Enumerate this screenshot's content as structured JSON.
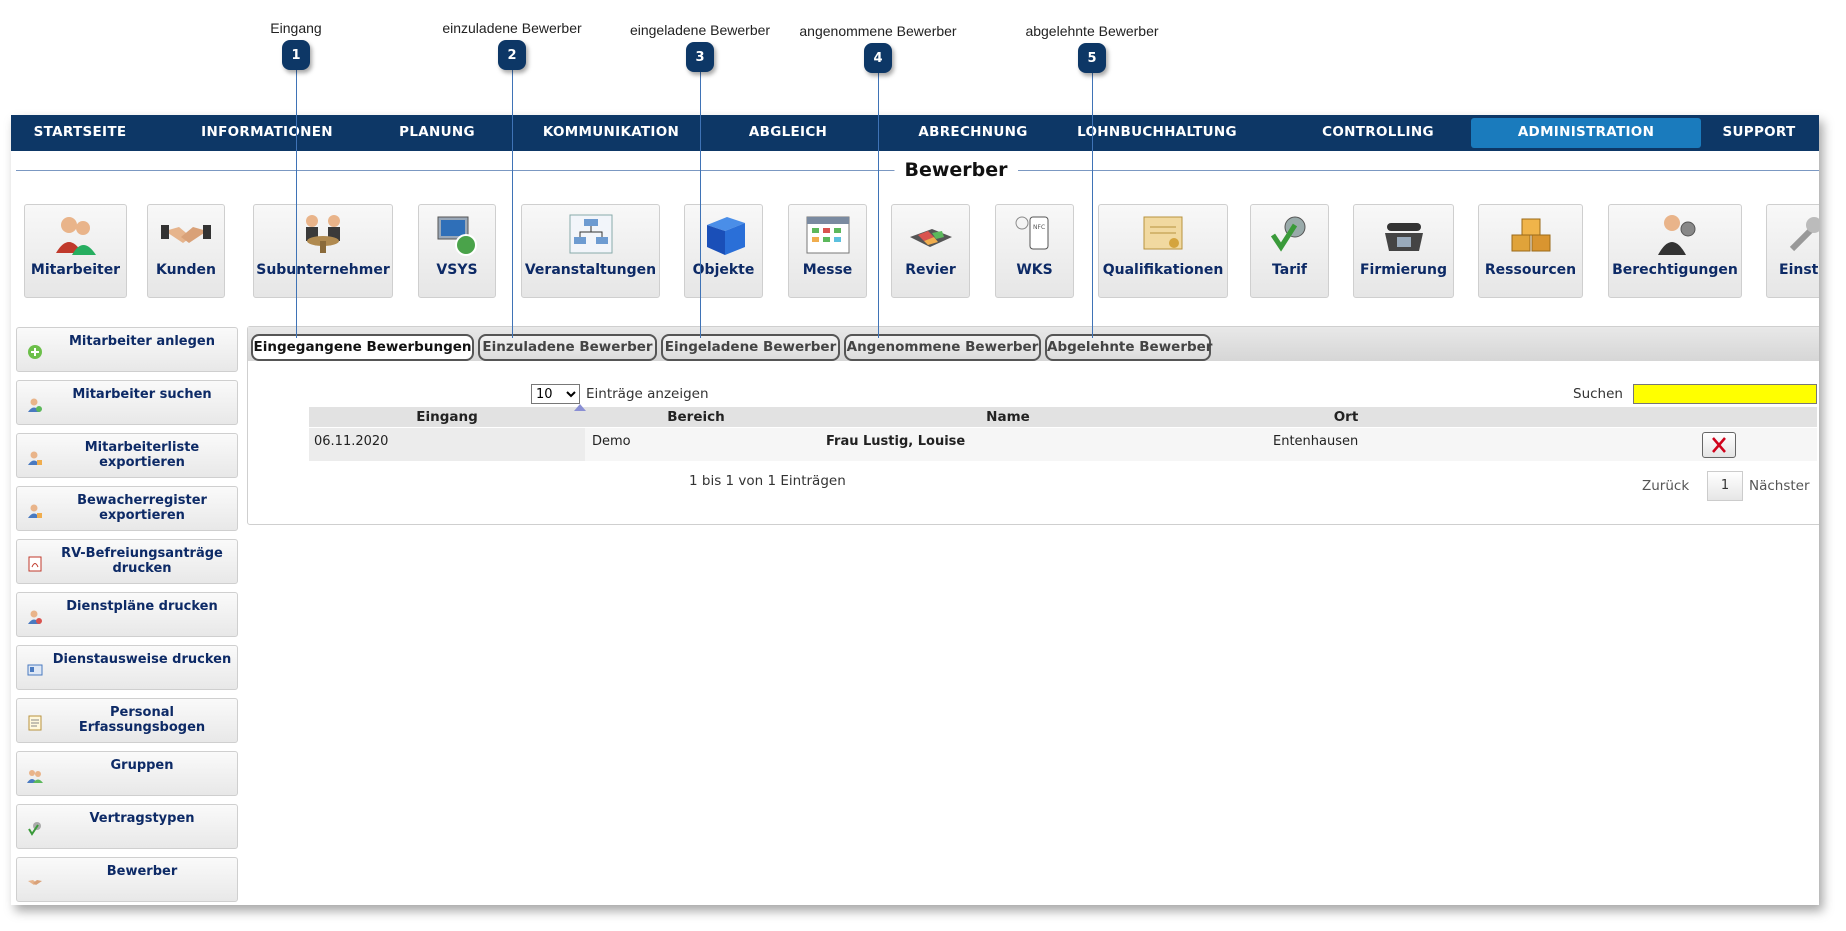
{
  "annotations": [
    {
      "number": "1",
      "label": "Eingang"
    },
    {
      "number": "2",
      "label": "einzuladene Bewerber"
    },
    {
      "number": "3",
      "label": "eingeladene Bewerber"
    },
    {
      "number": "4",
      "label": "angenommene Bewerber"
    },
    {
      "number": "5",
      "label": "abgelehnte Bewerber"
    }
  ],
  "nav": {
    "items": [
      "STARTSEITE",
      "INFORMATIONEN",
      "PLANUNG",
      "KOMMUNIKATION",
      "ABGLEICH",
      "ABRECHNUNG",
      "LOHNBUCHHALTUNG",
      "CONTROLLING",
      "ADMINISTRATION",
      "SUPPORT"
    ],
    "active": "ADMINISTRATION",
    "active_color": "#1a7bbd",
    "bar_color": "#0d3766"
  },
  "page_title": "Bewerber",
  "modules": [
    {
      "label": "Mitarbeiter",
      "icon": "users-icon"
    },
    {
      "label": "Kunden",
      "icon": "handshake-icon"
    },
    {
      "label": "Subunternehmer",
      "icon": "partners-icon"
    },
    {
      "label": "VSYS",
      "icon": "computer-icon"
    },
    {
      "label": "Veranstaltungen",
      "icon": "org-chart-icon"
    },
    {
      "label": "Objekte",
      "icon": "cube-icon"
    },
    {
      "label": "Messe",
      "icon": "calendar-icon"
    },
    {
      "label": "Revier",
      "icon": "map-icon"
    },
    {
      "label": "WKS",
      "icon": "nfc-icon"
    },
    {
      "label": "Qualifikationen",
      "icon": "certificate-icon"
    },
    {
      "label": "Tarif",
      "icon": "tariff-icon"
    },
    {
      "label": "Firmierung",
      "icon": "telephone-icon"
    },
    {
      "label": "Ressourcen",
      "icon": "boxes-icon"
    },
    {
      "label": "Berechtigungen",
      "icon": "admin-user-icon"
    },
    {
      "label": "Einste",
      "icon": "wrench-icon"
    }
  ],
  "sidebar": [
    {
      "label": "Mitarbeiter anlegen",
      "icon": "add-icon"
    },
    {
      "label": "Mitarbeiter suchen",
      "icon": "user-search-icon"
    },
    {
      "label": "Mitarbeiterliste exportieren",
      "icon": "user-export-icon"
    },
    {
      "label": "Bewacherregister exportieren",
      "icon": "user-export-icon"
    },
    {
      "label": "RV-Befreiungsanträge drucken",
      "icon": "pdf-icon"
    },
    {
      "label": "Dienstpläne drucken",
      "icon": "user-print-icon"
    },
    {
      "label": "Dienstausweise drucken",
      "icon": "id-card-icon"
    },
    {
      "label": "Personal Erfassungsbogen",
      "icon": "form-icon"
    },
    {
      "label": "Gruppen",
      "icon": "group-icon"
    },
    {
      "label": "Vertragstypen",
      "icon": "contract-icon"
    },
    {
      "label": "Bewerber",
      "icon": "handshake-icon"
    }
  ],
  "tabs": [
    {
      "label": "Eingegangene Bewerbungen",
      "active": true
    },
    {
      "label": "Einzuladene Bewerber",
      "active": false
    },
    {
      "label": "Eingeladene Bewerber",
      "active": false
    },
    {
      "label": "Angenommene Bewerber",
      "active": false
    },
    {
      "label": "Abgelehnte Bewerber",
      "active": false
    }
  ],
  "table_controls": {
    "page_length": "10",
    "page_length_suffix": "Einträge anzeigen",
    "search_label": "Suchen",
    "search_value": "",
    "search_color": "#ffff00"
  },
  "table": {
    "columns": [
      "Eingang",
      "Bereich",
      "Name",
      "Ort"
    ],
    "rows": [
      {
        "eingang": "06.11.2020",
        "bereich": "Demo",
        "name": "Frau Lustig, Louise",
        "ort": "Entenhausen"
      }
    ],
    "delete_icon": "delete-x-icon"
  },
  "pagination": {
    "info": "1 bis 1 von 1 Einträgen",
    "previous": "Zurück",
    "current_page": "1",
    "next": "Nächster"
  }
}
